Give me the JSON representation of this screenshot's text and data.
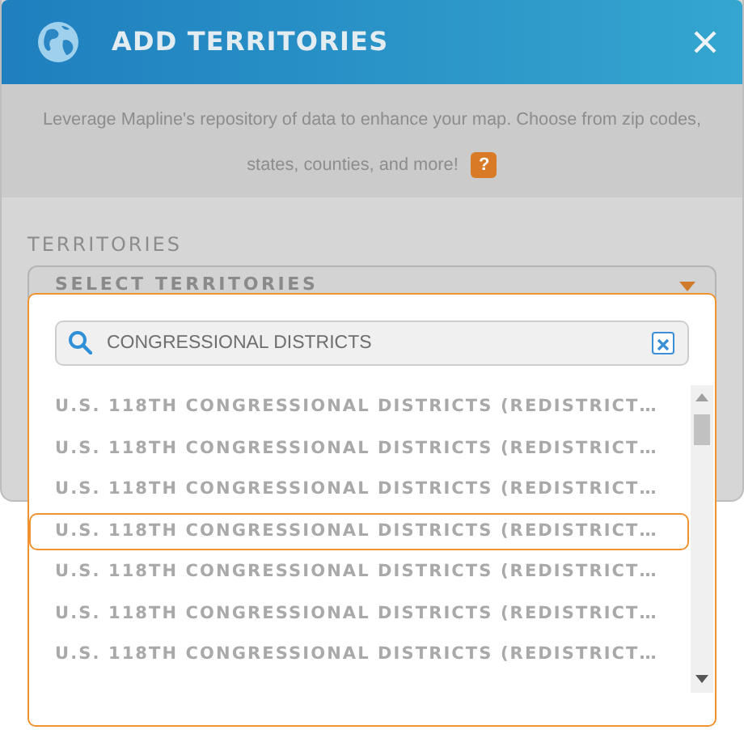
{
  "dialog": {
    "title": "ADD TERRITORIES",
    "description": "Leverage Mapline's repository of data to enhance your map. Choose from zip codes, states, counties, and more!",
    "help_badge": "?"
  },
  "field": {
    "label": "TERRITORIES",
    "select_placeholder": "SELECT TERRITORIES",
    "expanded": true
  },
  "search": {
    "value": "CONGRESSIONAL DISTRICTS"
  },
  "options": [
    {
      "label": "U.S. 118TH CONGRESSIONAL DISTRICTS (REDISTRICT…",
      "selected": false
    },
    {
      "label": "U.S. 118TH CONGRESSIONAL DISTRICTS (REDISTRICT…",
      "selected": false
    },
    {
      "label": "U.S. 118TH CONGRESSIONAL DISTRICTS (REDISTRICT…",
      "selected": false
    },
    {
      "label": "U.S. 118TH CONGRESSIONAL DISTRICTS (REDISTRICT…",
      "selected": true
    },
    {
      "label": "U.S. 118TH CONGRESSIONAL DISTRICTS (REDISTRICT…",
      "selected": false
    },
    {
      "label": "U.S. 118TH CONGRESSIONAL DISTRICTS (REDISTRICT…",
      "selected": false
    },
    {
      "label": "U.S. 118TH CONGRESSIONAL DISTRICTS (REDISTRICT…",
      "selected": false
    }
  ]
}
